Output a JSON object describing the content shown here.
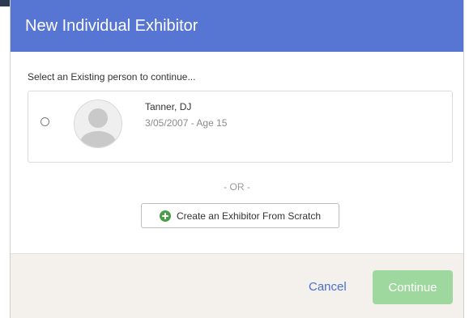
{
  "modal": {
    "title": "New Individual Exhibitor"
  },
  "body": {
    "instruction": "Select an Existing person to continue...",
    "person": {
      "name": "Tanner, DJ",
      "meta": "3/05/2007 - Age 15",
      "avatar_icon": "default-user-avatar-icon",
      "selected": false
    },
    "or_label": "- OR -",
    "scratch_button": {
      "label": "Create an Exhibitor From Scratch",
      "icon": "plus-circle-icon",
      "icon_color": "#4a9d4a"
    }
  },
  "footer": {
    "cancel_label": "Cancel",
    "continue_label": "Continue",
    "continue_color": "#9fd89f"
  },
  "colors": {
    "header": "#5776d3",
    "link": "#4b6fd1",
    "footer_bg": "#f4f0ec"
  }
}
